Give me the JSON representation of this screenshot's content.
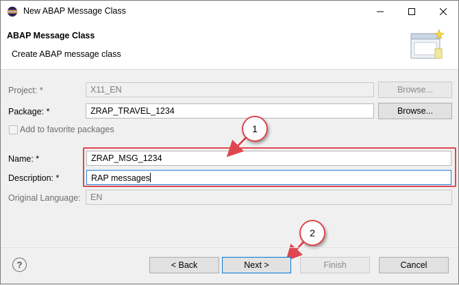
{
  "window": {
    "title": "New ABAP Message Class",
    "minimize_icon": "minimize-icon",
    "maximize_icon": "maximize-icon",
    "close_icon": "close-icon"
  },
  "header": {
    "title": "ABAP Message Class",
    "subtitle": "Create ABAP message class",
    "banner_icon": "wizard-banner-icon"
  },
  "form": {
    "project": {
      "label": "Project: *",
      "value": "X11_EN",
      "browse": "Browse..."
    },
    "package": {
      "label": "Package: *",
      "value": "ZRAP_TRAVEL_1234",
      "browse": "Browse..."
    },
    "favorite": {
      "label": "Add to favorite packages",
      "checked": false
    },
    "name": {
      "label": "Name: *",
      "value": "ZRAP_MSG_1234"
    },
    "description": {
      "label": "Description: *",
      "value": "RAP messages"
    },
    "language": {
      "label": "Original Language:",
      "value": "EN"
    }
  },
  "callouts": [
    "1",
    "2"
  ],
  "buttons": {
    "back": "< Back",
    "next": "Next >",
    "finish": "Finish",
    "cancel": "Cancel"
  },
  "colors": {
    "accent": "#0078d7",
    "annotation": "#e0464f"
  }
}
